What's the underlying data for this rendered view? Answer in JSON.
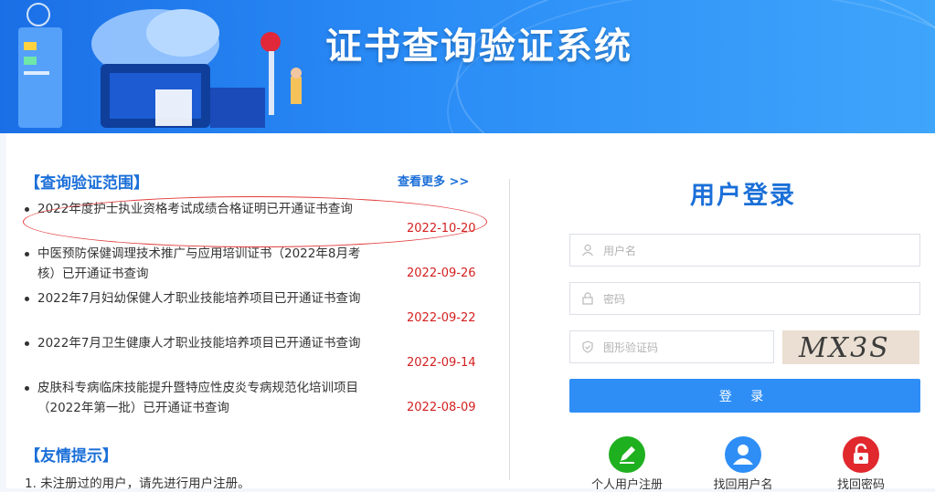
{
  "header": {
    "title": "证书查询验证系统"
  },
  "left": {
    "scope_title": "【查询验证范围】",
    "more_label": "查看更多 >>",
    "news": [
      {
        "text": "2022年度护士执业资格考试成绩合格证明已开通证书查询",
        "date": "2022-10-20"
      },
      {
        "text": "中医预防保健调理技术推广与应用培训证书（2022年8月考核）已开通证书查询",
        "date": "2022-09-26"
      },
      {
        "text": "2022年7月妇幼保健人才职业技能培养项目已开通证书查询",
        "date": "2022-09-22"
      },
      {
        "text": "2022年7月卫生健康人才职业技能培养项目已开通证书查询",
        "date": "2022-09-14"
      },
      {
        "text": "皮肤科专病临床技能提升暨特应性皮炎专病规范化培训项目（2022年第一批）已开通证书查询",
        "date": "2022-08-09"
      }
    ],
    "tips_title": "【友情提示】",
    "tips": [
      "1. 未注册过的用户，请先进行用户注册。"
    ]
  },
  "login": {
    "title": "用户登录",
    "username_placeholder": "用户名",
    "password_placeholder": "密码",
    "captcha_placeholder": "图形验证码",
    "captcha_text": "MX3S",
    "submit_label": "登 录",
    "actions": [
      {
        "label": "个人用户注册",
        "icon": "pencil-icon",
        "color": "#1fb01f"
      },
      {
        "label": "找回用户名",
        "icon": "user-icon",
        "color": "#2e8ef6"
      },
      {
        "label": "找回密码",
        "icon": "lock-icon",
        "color": "#e0282d"
      }
    ]
  },
  "colors": {
    "accent": "#1b6fd8",
    "date": "#d42020",
    "button": "#2e8ef6"
  }
}
